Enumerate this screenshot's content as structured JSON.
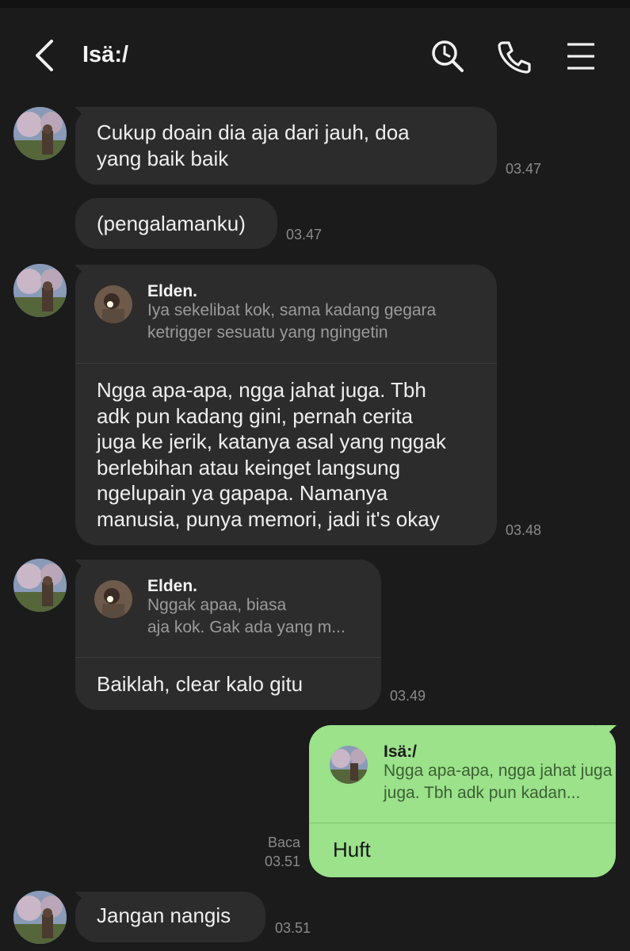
{
  "header": {
    "title": "Isä:/",
    "icons": [
      "back-arrow-icon",
      "search-icon",
      "phone-icon",
      "menu-icon"
    ]
  },
  "messages": [
    {
      "text_lines": [
        "Cukup doain dia aja dari jauh, doa",
        "yang baik baik"
      ],
      "time": "03.47"
    },
    {
      "text_lines": [
        "(pengalamanku)"
      ],
      "time": "03.47"
    },
    {
      "reply": {
        "name": "Elden.",
        "text_lines": [
          "Iya sekelibat kok, sama kadang gegara",
          "ketrigger sesuatu yang ngingetin"
        ]
      },
      "text_lines": [
        "Ngga apa-apa, ngga jahat juga. Tbh",
        "adk pun kadang gini, pernah cerita",
        "juga ke jerik, katanya asal yang nggak",
        "berlebihan atau keinget langsung",
        "ngelupain ya gapapa. Namanya",
        "manusia, punya memori, jadi it's okay"
      ],
      "time": "03.48"
    },
    {
      "reply": {
        "name": "Elden.",
        "text_lines": [
          "Nggak apaa, biasa",
          "aja kok. Gak ada yang m..."
        ]
      },
      "text_lines": [
        "Baiklah, clear kalo gitu"
      ],
      "time": "03.49"
    },
    {
      "outgoing": true,
      "reply": {
        "name": "Isä:/",
        "text_lines": [
          "Ngga apa-apa, ngga jahat juga",
          "juga. Tbh adk pun kadan..."
        ]
      },
      "text_lines": [
        "Huft"
      ],
      "read_label": "Baca",
      "time": "03.51"
    },
    {
      "text_lines": [
        "Jangan nangis"
      ],
      "time": "03.51"
    }
  ],
  "colors": {
    "background": "#1b1b1b",
    "incoming_bubble": "#2c2c2c",
    "outgoing_bubble": "#9be28a",
    "timestamp": "#8a8a8a"
  }
}
